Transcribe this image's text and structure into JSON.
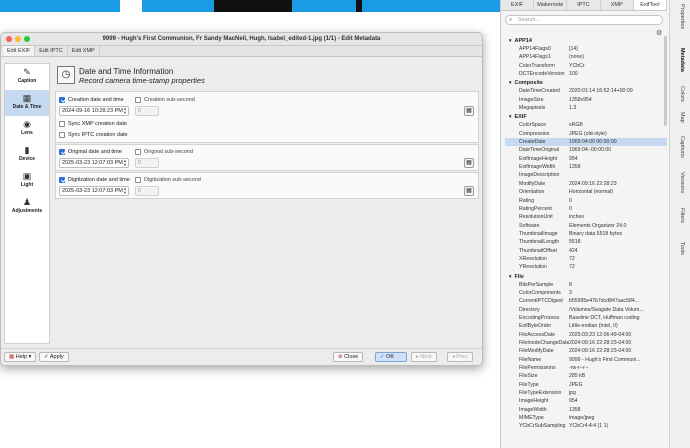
{
  "dialog": {
    "title": "9999 - Hugh's First Communion, Fr Sandy MacNeil, Hugh, Isabel_edited-1.jpg (1/1) - Edit Metadata",
    "tabs": [
      "Edit EXIF",
      "Edit IPTC",
      "Edit XMP"
    ],
    "sidebar": [
      {
        "label": "Caption",
        "icon": "caption-icon",
        "glyph": "✎"
      },
      {
        "label": "Date & Time",
        "icon": "calendar-icon",
        "glyph": "▦"
      },
      {
        "label": "Lens",
        "icon": "lens-icon",
        "glyph": "◉"
      },
      {
        "label": "Device",
        "icon": "device-icon",
        "glyph": "▮"
      },
      {
        "label": "Light",
        "icon": "light-icon",
        "glyph": "▣"
      },
      {
        "label": "Adjustments",
        "icon": "adjustments-icon",
        "glyph": "♟"
      }
    ],
    "header": {
      "title": "Date and Time Information",
      "subtitle": "Record camera time-stamp properties"
    },
    "creation": {
      "label": "Creation date and time",
      "subsecond_label": "Creation sub-second",
      "value": "2024-09-16 10:28:23 PM",
      "subsecond": "0",
      "sync_xmp": "Sync XMP creation date",
      "sync_iptc": "Sync IPTC creation date"
    },
    "original": {
      "label": "Original date and time",
      "subsecond_label": "Original sub-second",
      "value": "2025-03-23 12:07:03 PM",
      "subsecond": "0"
    },
    "digitization": {
      "label": "Digitization date and time",
      "subsecond_label": "Digitization sub-second",
      "value": "2025-03-23 12:07:03 PM",
      "subsecond": "0"
    },
    "footer": {
      "help": "Help",
      "apply": "Apply",
      "close": "Close",
      "ok": "OK",
      "next": "Next",
      "prev": "Prev"
    }
  },
  "panel": {
    "tabs": [
      "EXIF",
      "Makernote",
      "IPTC",
      "XMP",
      "ExifTool"
    ],
    "active_tab": "ExifTool",
    "search_placeholder": "Search...",
    "vertical_tabs": [
      "Properties",
      "Metadata",
      "Colors",
      "Map",
      "Captions",
      "Versions",
      "Filters",
      "Tools"
    ],
    "sections": [
      {
        "name": "APP14",
        "rows": [
          [
            "APP14Flags0",
            "[14]"
          ],
          [
            "APP14Flags1",
            "(none)"
          ],
          [
            "ColorTransform",
            "YCbCr"
          ],
          [
            "DCTEncodeVersion",
            "100"
          ]
        ]
      },
      {
        "name": "Composite",
        "rows": [
          [
            "DateTimeCreated",
            "2020:01:14 16:52:14+00:00"
          ],
          [
            "ImageSize",
            "1358x954"
          ],
          [
            "Megapixels",
            "1.3"
          ]
        ]
      },
      {
        "name": "EXIF",
        "rows": [
          [
            "ColorSpace",
            "sRGB"
          ],
          [
            "Compression",
            "JPEG (old-style)"
          ],
          [
            "CreateDate",
            "1969:04:00 00:00:00"
          ],
          [
            "DateTimeOriginal",
            "1969:04:-00:00:00"
          ],
          [
            "ExifImageHeight",
            "954"
          ],
          [
            "ExifImageWidth",
            "1358"
          ],
          [
            "ImageDescription",
            ""
          ],
          [
            "ModifyDate",
            "2024:09:16 22:28:23"
          ],
          [
            "Orientation",
            "Horizontal (normal)"
          ],
          [
            "Rating",
            "0"
          ],
          [
            "RatingPercent",
            "0"
          ],
          [
            "ResolutionUnit",
            "inches"
          ],
          [
            "Software",
            "Elements Organizer 24.0"
          ],
          [
            "ThumbnailImage",
            "Binary data 5518 bytes"
          ],
          [
            "ThumbnailLength",
            "5518"
          ],
          [
            "ThumbnailOffset",
            "424"
          ],
          [
            "XResolution",
            "72"
          ],
          [
            "YResolution",
            "72"
          ]
        ]
      },
      {
        "name": "File",
        "rows": [
          [
            "BitsPerSample",
            "8"
          ],
          [
            "ColorComponents",
            "3"
          ],
          [
            "CurrentIPTCDigest",
            "b55995e47b7dcd847aac584..."
          ],
          [
            "Directory",
            "/Volumes/Seagate Data Volum..."
          ],
          [
            "EncodingProcess",
            "Baseline DCT, Huffman coding"
          ],
          [
            "ExifByteOrder",
            "Little-endian (Intel, II)"
          ],
          [
            "FileAccessDate",
            "2025:03:23 12:06:49-04:00"
          ],
          [
            "FileInodeChangeDate",
            "2024:09:16 22:28:23-04:00"
          ],
          [
            "FileModifyDate",
            "2024:09:16 22:28:23-04:00"
          ],
          [
            "FileName",
            "9999 - Hugh's First Communi..."
          ],
          [
            "FilePermissions",
            "-rw-r--r--"
          ],
          [
            "FileSize",
            "285 kB"
          ],
          [
            "FileType",
            "JPEG"
          ],
          [
            "FileTypeExtension",
            "jpg"
          ],
          [
            "ImageHeight",
            "954"
          ],
          [
            "ImageWidth",
            "1358"
          ],
          [
            "MIMEType",
            "image/jpeg"
          ],
          [
            "YCbCrSubSampling",
            "YCbCr4:4:4 (1 1)"
          ]
        ]
      }
    ],
    "selected_row": "CreateDate"
  }
}
